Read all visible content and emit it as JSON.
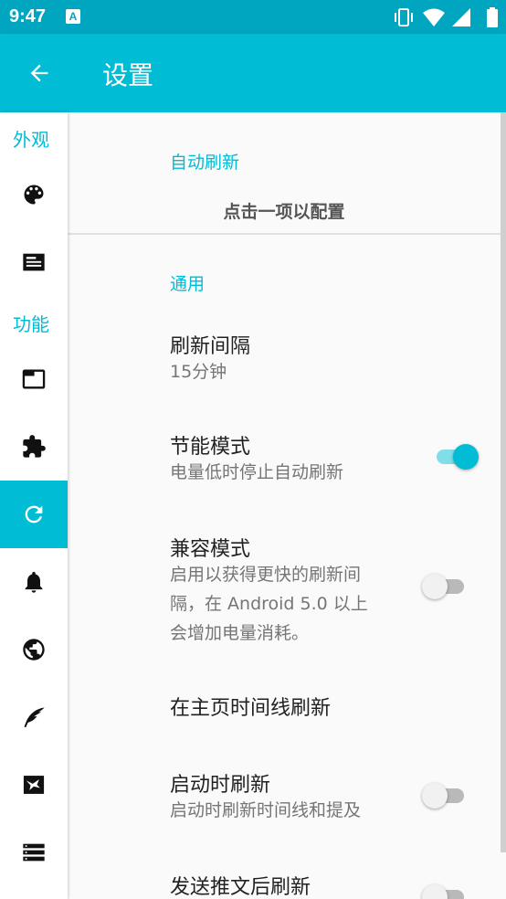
{
  "status_bar": {
    "time": "9:47",
    "notification_badge": "A",
    "icons": [
      "vibrate-icon",
      "wifi-icon",
      "signal-icon",
      "battery-icon"
    ]
  },
  "app_bar": {
    "title": "设置",
    "back_icon": "arrow-back-icon"
  },
  "sidebar": {
    "appearance_label": "外观",
    "function_label": "功能",
    "items": [
      {
        "icon": "palette-icon",
        "active": false
      },
      {
        "icon": "card-text-icon",
        "active": false
      },
      {
        "icon": "browser-window-icon",
        "active": false
      },
      {
        "icon": "extension-icon",
        "active": false
      },
      {
        "icon": "refresh-icon",
        "active": true
      },
      {
        "icon": "notification-bell-icon",
        "active": false
      },
      {
        "icon": "globe-icon",
        "active": false
      },
      {
        "icon": "quill-icon",
        "active": false
      },
      {
        "icon": "bird-frame-icon",
        "active": false
      },
      {
        "icon": "storage-list-icon",
        "active": false
      }
    ]
  },
  "content": {
    "auto_refresh_category": "自动刷新",
    "auto_refresh_info": "点击一项以配置",
    "general_category": "通用",
    "prefs": [
      {
        "title": "刷新间隔",
        "summary": "15分钟"
      },
      {
        "title": "节能模式",
        "summary": "电量低时停止自动刷新",
        "switch_on": true
      },
      {
        "title": "兼容模式",
        "summary_lines": [
          "启用以获得更快的刷新间",
          "隔，在 Android 5.0 以上",
          "会增加电量消耗。"
        ],
        "switch_on": false
      },
      {
        "title": "在主页时间线刷新"
      },
      {
        "title": "启动时刷新",
        "summary": "启动时刷新时间线和提及",
        "switch_on": false
      },
      {
        "title": "发送推文后刷新",
        "switch_on": false
      }
    ]
  },
  "colors": {
    "accent": "#00bcd4",
    "status_bar": "#00a5c0",
    "switch_track_on": "#80deea"
  }
}
